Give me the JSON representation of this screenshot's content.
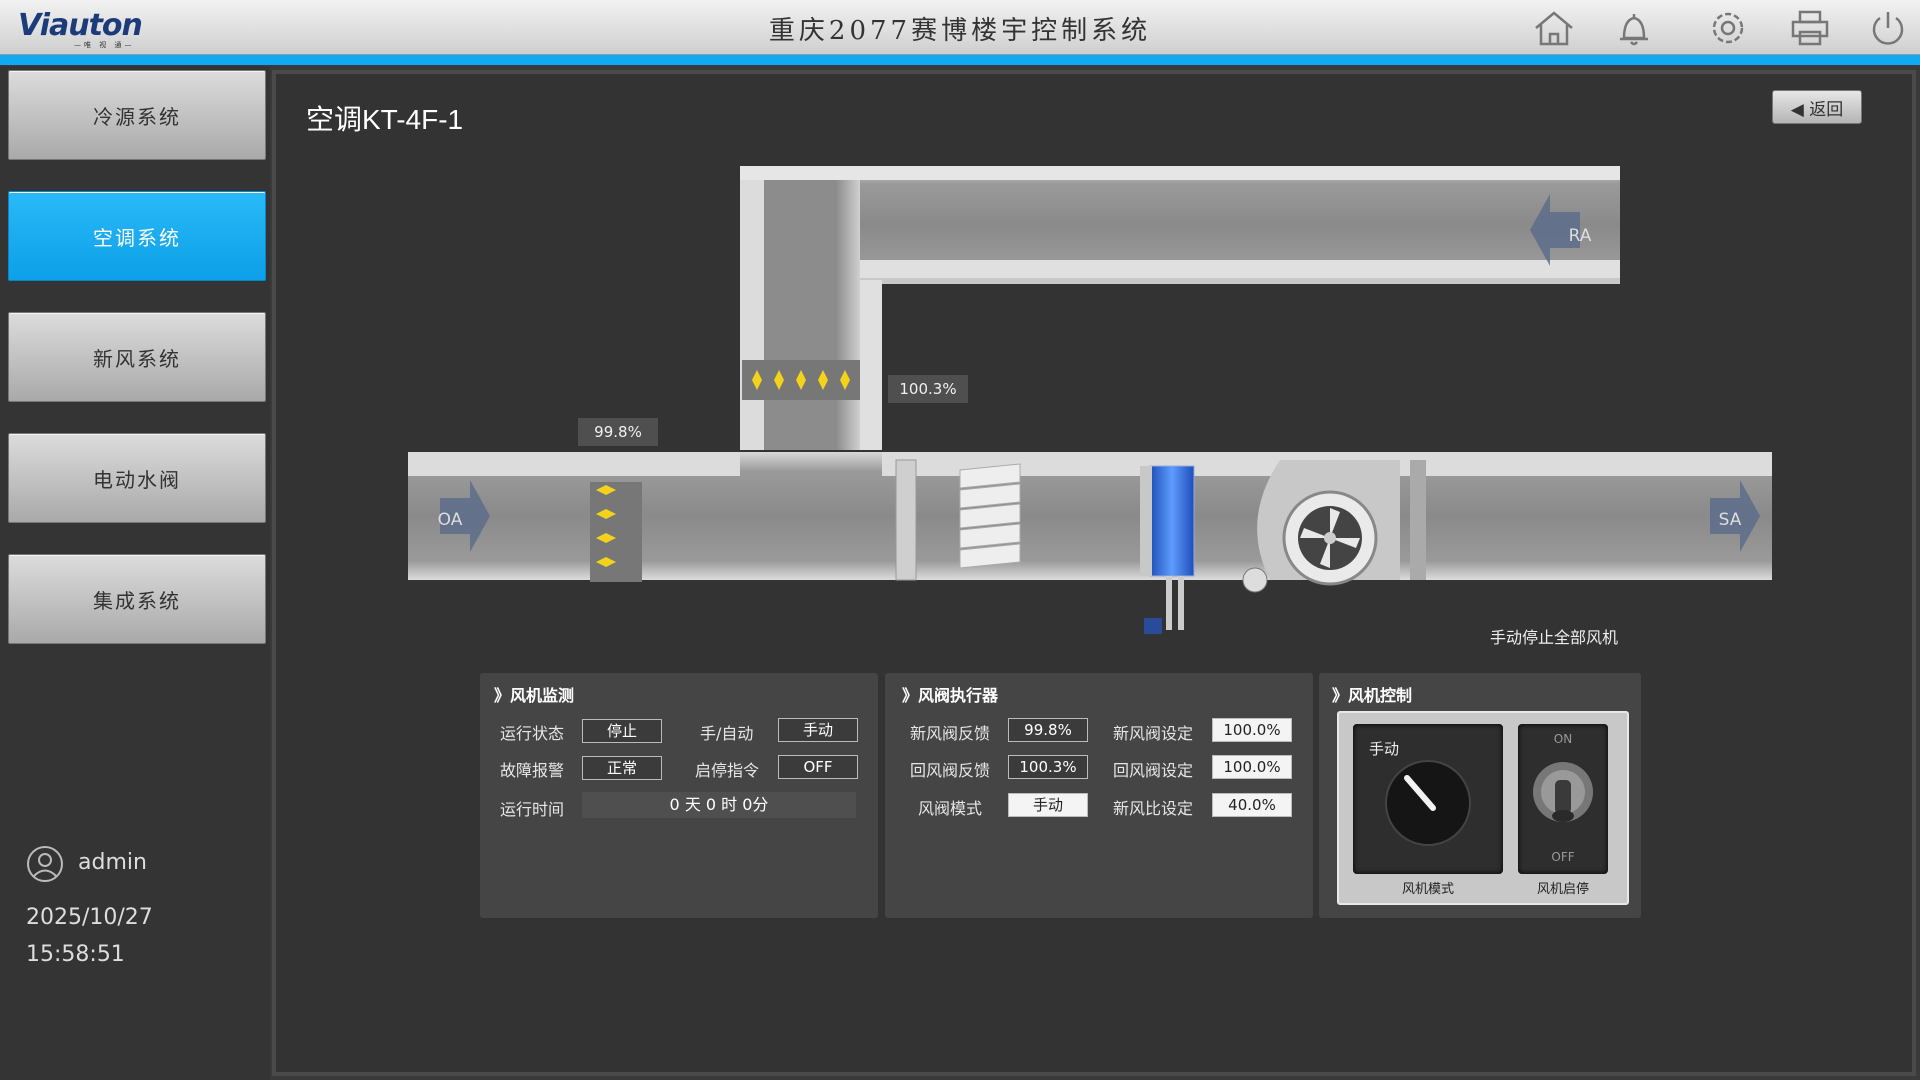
{
  "header": {
    "logo_text": "Viauton",
    "logo_sub": "—唯 视 通—",
    "title": "重庆2077赛博楼宇控制系统",
    "icons": [
      "home-icon",
      "bell-icon",
      "gear-icon",
      "printer-icon",
      "power-icon"
    ]
  },
  "sidebar": {
    "items": [
      {
        "label": "冷源系统",
        "active": false
      },
      {
        "label": "空调系统",
        "active": true
      },
      {
        "label": "新风系统",
        "active": false
      },
      {
        "label": "电动水阀",
        "active": false
      },
      {
        "label": "集成系统",
        "active": false
      }
    ],
    "user": "admin",
    "date": "2025/10/27",
    "time": "15:58:51"
  },
  "main": {
    "title": "空调KT-4F-1",
    "back_label": "◀ 返回"
  },
  "diagram": {
    "oa_label": "OA",
    "sa_label": "SA",
    "ra_label": "RA",
    "fresh_damper_pct": "99.8%",
    "return_damper_pct": "100.3%",
    "manual_stop": "手动停止全部风机"
  },
  "fan_monitor": {
    "title": "》风机监测",
    "run_state_label": "运行状态",
    "run_state": "停止",
    "hand_auto_label": "手/自动",
    "hand_auto": "手动",
    "fault_label": "故障报警",
    "fault": "正常",
    "start_cmd_label": "启停指令",
    "start_cmd": "OFF",
    "runtime_label": "运行时间",
    "runtime": "0 天 0 时 0分"
  },
  "damper": {
    "title": "》风阀执行器",
    "fresh_fb_label": "新风阀反馈",
    "fresh_fb": "99.8%",
    "fresh_set_label": "新风阀设定",
    "fresh_set": "100.0%",
    "return_fb_label": "回风阀反馈",
    "return_fb": "100.3%",
    "return_set_label": "回风阀设定",
    "return_set": "100.0%",
    "mode_label": "风阀模式",
    "mode": "手动",
    "ratio_label": "新风比设定",
    "ratio": "40.0%"
  },
  "fan_control": {
    "title": "》风机控制",
    "knob_label": "手动",
    "knob_caption": "风机模式",
    "toggle_on": "ON",
    "toggle_off": "OFF",
    "toggle_caption": "风机启停"
  },
  "colors": {
    "accent": "#11a9f2",
    "nav_active": "#1aaef5",
    "background": "#333333"
  }
}
